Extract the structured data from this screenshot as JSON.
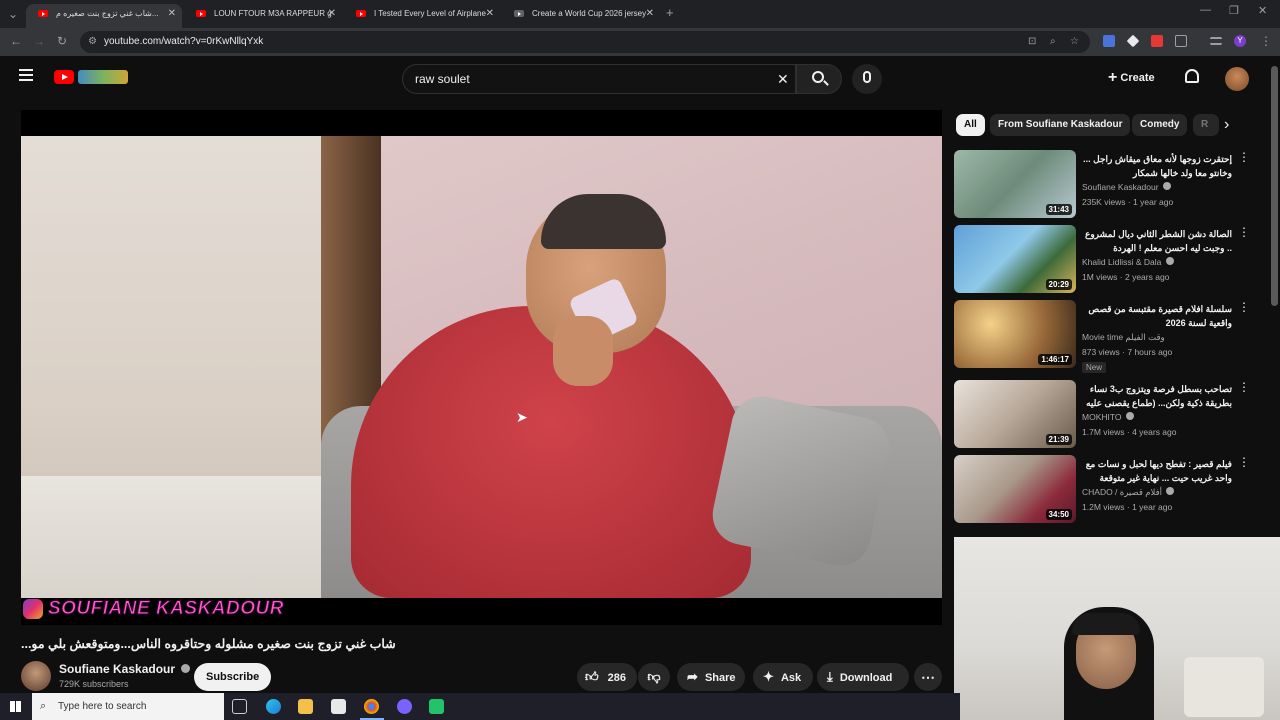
{
  "browser": {
    "tabs": [
      {
        "title": "شاب غني تزوج بنت صغيره م...",
        "active": true
      },
      {
        "title": "LOUN FTOUR M3A RAPPEUR g",
        "active": false
      },
      {
        "title": "I Tested Every Level of Airplane",
        "active": false
      },
      {
        "title": "Create a World Cup 2026 jersey",
        "active": false
      }
    ],
    "url": "youtube.com/watch?v=0rKwNllqYxk"
  },
  "youtube": {
    "search_query": "raw soulet",
    "create_label": "Create"
  },
  "video": {
    "watermark": "SOUFIANE KASKADOUR",
    "title": "شاب غني تزوج بنت صغيره مشلوله وحتاقروه الناس...ومتوقعش بلي مو...",
    "channel": "Soufiane Kaskadour",
    "subscribers": "729K subscribers",
    "subscribe_label": "Subscribe",
    "likes": "286",
    "share_label": "Share",
    "ask_label": "Ask",
    "download_label": "Download"
  },
  "chips": [
    "All",
    "From Soufiane Kaskadour",
    "Comedy",
    "R"
  ],
  "recommendations": [
    {
      "title": "إحتقرت زوجها لأنه معاق ميقاش راجل ... وخانتو معا ولد خالها شمكار",
      "channel": "Soufiane Kaskadour",
      "verified": true,
      "meta": "235K views · 1 year ago",
      "duration": "31:43",
      "badge": ""
    },
    {
      "title": "الصالة دشن الشطر الثاني ديال لمشروع .. وجبت ليه احسن معلم ! الهردة",
      "channel": "Khalid Lidlissi & Dala",
      "verified": true,
      "meta": "1M views · 2 years ago",
      "duration": "20:29",
      "badge": ""
    },
    {
      "title": "سلسلة افلام قصيرة مقتبسة من قصص واقعية لسنة 2026",
      "channel": "Movie time وقت الفيلم",
      "verified": false,
      "meta": "873 views · 7 hours ago",
      "duration": "1:46:17",
      "badge": "New"
    },
    {
      "title": "تصاحب بسطل فرصة ويتزوج ب3 نساء بطريقة ذكية ولكن... (طماع يقصنى عليه",
      "channel": "MOKHITO",
      "verified": true,
      "meta": "1.7M views · 4 years ago",
      "duration": "21:39",
      "badge": ""
    },
    {
      "title": "فيلم قصير : تفطح ديها لحبل و نسات مع واحد غريب حيت ... نهاية غير متوقعة",
      "channel": "CHADO / أفلام قصيرة",
      "verified": true,
      "meta": "1.2M views · 1 year ago",
      "duration": "34:50",
      "badge": ""
    }
  ],
  "taskbar": {
    "search_placeholder": "Type here to search"
  }
}
